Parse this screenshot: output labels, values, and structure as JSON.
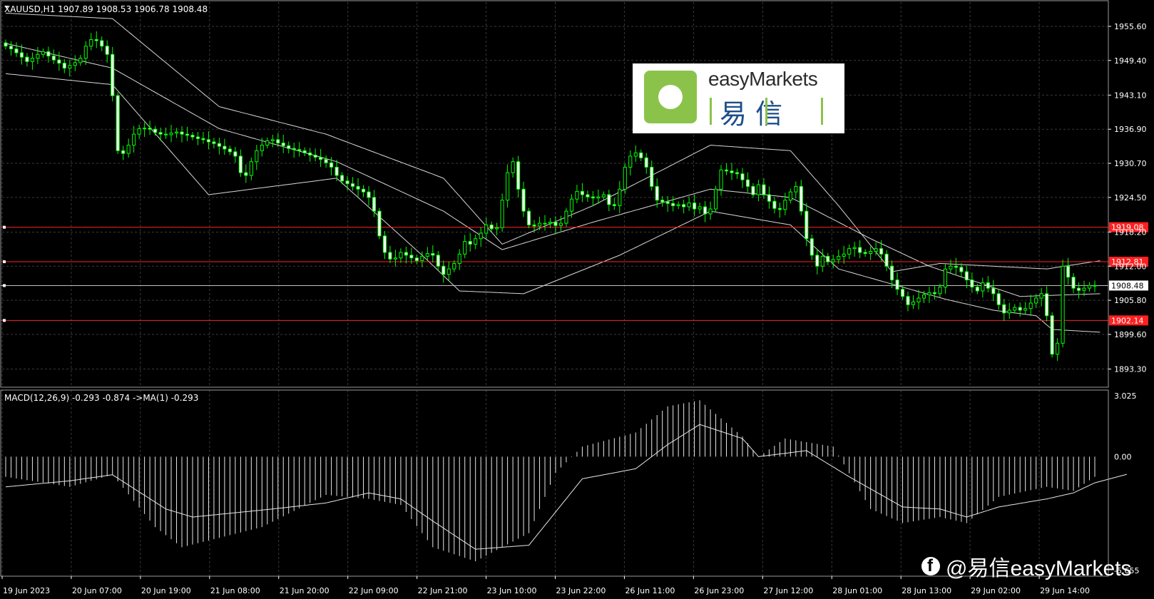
{
  "chart_data": [
    {
      "type": "candlestick",
      "title": "XAUUSD,H1  1907.89 1908.53 1906.78 1908.48",
      "symbol": "XAUUSD",
      "timeframe": "H1",
      "ylim": [
        1890.0,
        1960.0
      ],
      "y_ticks": [
        "1955.60",
        "1949.40",
        "1943.10",
        "1936.90",
        "1930.70",
        "1924.50",
        "1918.20",
        "1912.00",
        "1905.80",
        "1899.60",
        "1893.30"
      ],
      "x_ticks": [
        "19 Jun 2023",
        "20 Jun 07:00",
        "20 Jun 19:00",
        "21 Jun 08:00",
        "21 Jun 20:00",
        "22 Jun 09:00",
        "22 Jun 21:00",
        "23 Jun 10:00",
        "23 Jun 22:00",
        "26 Jun 11:00",
        "26 Jun 23:00",
        "27 Jun 12:00",
        "28 Jun 01:00",
        "28 Jun 13:00",
        "29 Jun 02:00",
        "29 Jun 14:00"
      ],
      "close_series": [
        1952.0,
        1951.5,
        1950.8,
        1950.0,
        1949.2,
        1949.8,
        1950.5,
        1951.0,
        1950.2,
        1949.5,
        1948.9,
        1948.0,
        1948.5,
        1949.0,
        1949.8,
        1952.0,
        1953.2,
        1953.0,
        1952.0,
        1950.5,
        1943.0,
        1933.0,
        1932.5,
        1934.0,
        1936.0,
        1937.0,
        1937.1,
        1936.9,
        1936.3,
        1936.0,
        1935.9,
        1936.2,
        1936.4,
        1936.0,
        1935.8,
        1935.5,
        1935.2,
        1935.0,
        1934.6,
        1934.3,
        1933.8,
        1933.3,
        1932.8,
        1932.0,
        1929.0,
        1928.5,
        1931.0,
        1933.0,
        1934.0,
        1934.8,
        1935.0,
        1934.4,
        1933.9,
        1933.4,
        1933.2,
        1933.0,
        1932.6,
        1932.2,
        1931.8,
        1931.4,
        1930.8,
        1930.0,
        1928.5,
        1927.5,
        1927.0,
        1926.5,
        1926.0,
        1925.5,
        1924.5,
        1922.0,
        1917.5,
        1914.5,
        1913.3,
        1913.5,
        1914.5,
        1914.0,
        1913.5,
        1913.0,
        1913.8,
        1914.3,
        1914.0,
        1912.0,
        1910.5,
        1911.5,
        1912.5,
        1914.2,
        1916.5,
        1916.0,
        1917.0,
        1918.0,
        1919.5,
        1918.8,
        1919.0,
        1924.0,
        1929.0,
        1931.0,
        1926.0,
        1922.0,
        1919.5,
        1919.3,
        1919.8,
        1919.8,
        1920.0,
        1919.4,
        1919.8,
        1922.0,
        1924.2,
        1925.6,
        1925.0,
        1924.6,
        1924.4,
        1924.6,
        1925.0,
        1923.2,
        1923.0,
        1926.0,
        1930.0,
        1932.0,
        1932.6,
        1931.7,
        1930.0,
        1926.5,
        1924.0,
        1923.7,
        1923.4,
        1923.0,
        1923.2,
        1922.8,
        1923.5,
        1922.4,
        1922.8,
        1921.5,
        1922.4,
        1926.0,
        1929.5,
        1929.3,
        1929.0,
        1928.8,
        1927.7,
        1926.5,
        1925.0,
        1926.8,
        1925.0,
        1923.8,
        1922.5,
        1922.3,
        1924.0,
        1925.5,
        1926.5,
        1922.0,
        1917.0,
        1914.0,
        1912.0,
        1913.8,
        1912.8,
        1913.2,
        1913.8,
        1914.2,
        1915.2,
        1915.4,
        1914.5,
        1914.3,
        1914.7,
        1915.2,
        1914.2,
        1912.0,
        1909.5,
        1907.8,
        1906.5,
        1905.0,
        1905.5,
        1906.2,
        1906.8,
        1907.2,
        1907.0,
        1908.2,
        1911.5,
        1912.0,
        1911.8,
        1911.0,
        1909.5,
        1908.2,
        1907.5,
        1909.0,
        1908.0,
        1907.0,
        1905.0,
        1903.5,
        1904.0,
        1904.5,
        1904.0,
        1904.3,
        1905.3,
        1906.2,
        1907.0,
        1903.0,
        1896.0,
        1898.0,
        1912.0,
        1910.0,
        1908.0,
        1907.6,
        1908.0,
        1908.5,
        1908.48
      ],
      "bollinger": {
        "upper_anchors": [
          [
            0,
            1958
          ],
          [
            20,
            1957
          ],
          [
            40,
            1941
          ],
          [
            60,
            1936
          ],
          [
            82,
            1928
          ],
          [
            93,
            1916
          ],
          [
            110,
            1923
          ],
          [
            132,
            1934
          ],
          [
            147,
            1933
          ],
          [
            156,
            1923
          ],
          [
            166,
            1911
          ],
          [
            175,
            1912.5
          ],
          [
            195,
            1911.5
          ],
          [
            205,
            1913
          ]
        ],
        "middle_anchors": [
          [
            0,
            1952.5
          ],
          [
            20,
            1948
          ],
          [
            40,
            1937
          ],
          [
            62,
            1931
          ],
          [
            82,
            1922
          ],
          [
            93,
            1915
          ],
          [
            110,
            1920
          ],
          [
            132,
            1926
          ],
          [
            147,
            1924.5
          ],
          [
            162,
            1917
          ],
          [
            173,
            1912
          ],
          [
            190,
            1906.5
          ],
          [
            205,
            1907
          ]
        ],
        "lower_anchors": [
          [
            0,
            1947
          ],
          [
            20,
            1945
          ],
          [
            38,
            1925
          ],
          [
            62,
            1928
          ],
          [
            78,
            1914
          ],
          [
            85,
            1907.5
          ],
          [
            97,
            1907
          ],
          [
            115,
            1914
          ],
          [
            132,
            1922
          ],
          [
            147,
            1919.5
          ],
          [
            156,
            1911.5
          ],
          [
            176,
            1906
          ],
          [
            185,
            1904
          ],
          [
            193,
            1903
          ],
          [
            196,
            1900.5
          ],
          [
            205,
            1900
          ]
        ]
      },
      "horizontal_lines": [
        {
          "label": "1919.08",
          "price": 1919.08,
          "color": "#ff2020"
        },
        {
          "label": "1912.81",
          "price": 1912.81,
          "color": "#ff2020"
        },
        {
          "label": "1908.48",
          "price": 1908.48,
          "color": "#c0c0c0"
        },
        {
          "label": "1902.14",
          "price": 1902.14,
          "color": "#ff2020"
        }
      ],
      "colors": {
        "bull": "#00ff00",
        "bear": "#ffffff",
        "candle_fill": "#ffffff",
        "grid": "#3a3a3a",
        "axis": "#ffffff"
      }
    },
    {
      "type": "histogram",
      "title": "MACD(12,26,9) -0.293 -0.874  ->MA(1) -0.293",
      "ylim": [
        -5.655,
        3.025
      ],
      "y_ticks": [
        "3.025",
        "0.00",
        "-5.655"
      ],
      "macd_anchors": [
        [
          0,
          -1.0
        ],
        [
          12,
          -1.5
        ],
        [
          20,
          -0.9
        ],
        [
          28,
          -3.5
        ],
        [
          33,
          -4.5
        ],
        [
          48,
          -3.5
        ],
        [
          60,
          -1.9
        ],
        [
          68,
          -2.1
        ],
        [
          74,
          -2.4
        ],
        [
          80,
          -4.5
        ],
        [
          88,
          -5.2
        ],
        [
          98,
          -3.8
        ],
        [
          103,
          -0.8
        ],
        [
          108,
          0.5
        ],
        [
          118,
          1.2
        ],
        [
          124,
          2.5
        ],
        [
          130,
          2.8
        ],
        [
          138,
          1.0
        ],
        [
          141,
          0.0
        ],
        [
          146,
          0.9
        ],
        [
          155,
          0.5
        ],
        [
          162,
          -2.6
        ],
        [
          168,
          -3.3
        ],
        [
          175,
          -3.0
        ],
        [
          180,
          -3.3
        ],
        [
          186,
          -2.0
        ],
        [
          195,
          -1.5
        ],
        [
          200,
          -1.7
        ],
        [
          204,
          -1.0
        ],
        [
          210,
          -0.3
        ]
      ],
      "signal_anchors": [
        [
          0,
          -1.5
        ],
        [
          12,
          -1.2
        ],
        [
          20,
          -0.9
        ],
        [
          30,
          -2.6
        ],
        [
          35,
          -3.0
        ],
        [
          50,
          -2.6
        ],
        [
          60,
          -2.3
        ],
        [
          68,
          -1.8
        ],
        [
          74,
          -2.1
        ],
        [
          80,
          -3.2
        ],
        [
          88,
          -4.6
        ],
        [
          98,
          -4.4
        ],
        [
          108,
          -1.1
        ],
        [
          118,
          -0.6
        ],
        [
          124,
          0.6
        ],
        [
          130,
          1.6
        ],
        [
          138,
          0.9
        ],
        [
          141,
          0.0
        ],
        [
          150,
          0.3
        ],
        [
          158,
          -1.0
        ],
        [
          168,
          -2.5
        ],
        [
          175,
          -2.6
        ],
        [
          180,
          -3.0
        ],
        [
          186,
          -2.5
        ],
        [
          195,
          -2.1
        ],
        [
          200,
          -1.8
        ],
        [
          204,
          -1.3
        ],
        [
          210,
          -0.874
        ]
      ]
    }
  ],
  "brand": {
    "logo_en": "easyMarkets",
    "logo_zh": "易  信",
    "watermark": "@易信easyMarkets"
  }
}
